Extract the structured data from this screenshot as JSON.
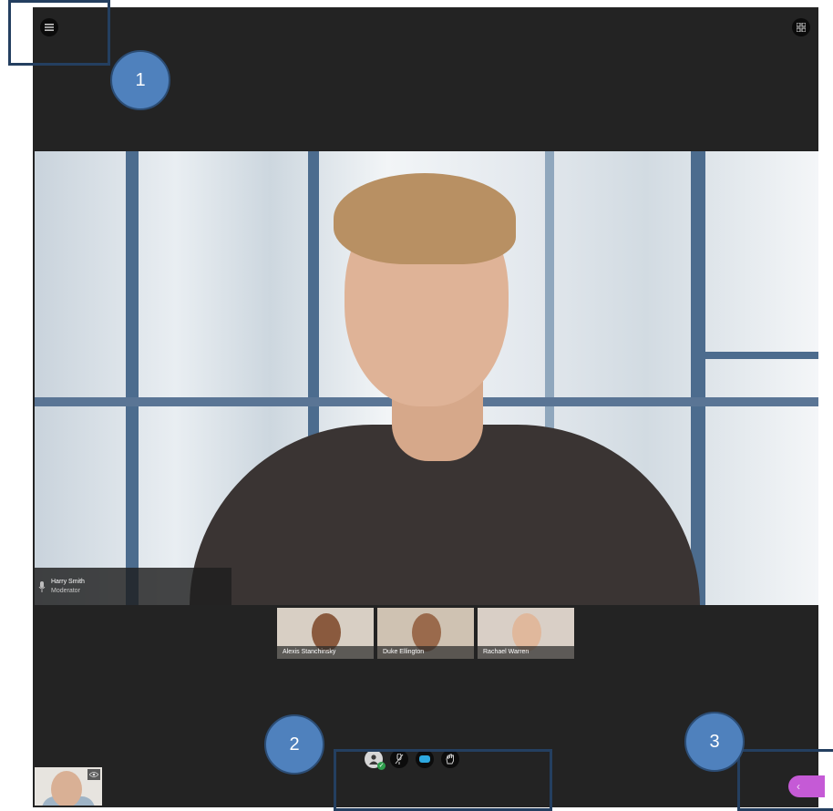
{
  "main_video": {
    "participant_name": "Harry Smith",
    "participant_role": "Moderator"
  },
  "participants": [
    {
      "name": "Alexis Stanchinsky",
      "skin": "#8a5a3e",
      "bg": "#d8cfc4"
    },
    {
      "name": "Duke Ellington",
      "skin": "#9a6a4c",
      "bg": "#cfc2b2"
    },
    {
      "name": "Rachael Warren",
      "skin": "#e0b89c",
      "bg": "#d9cfc6"
    }
  ],
  "controls": [
    {
      "name": "profile-status-button",
      "icon": "person-icon"
    },
    {
      "name": "mute-microphone-button",
      "icon": "microphone-muted-icon"
    },
    {
      "name": "camera-button",
      "icon": "camera-icon"
    },
    {
      "name": "raise-hand-button",
      "icon": "hand-icon"
    }
  ],
  "drawer": {
    "icon": "chevron-left-icon",
    "glyph": "‹"
  },
  "callouts": {
    "one": "1",
    "two": "2",
    "three": "3"
  },
  "colors": {
    "background": "#232323",
    "accent": "#c55ad6",
    "callout": "#4f81bd",
    "callout_border": "#243f60",
    "online": "#2e9e4c"
  }
}
